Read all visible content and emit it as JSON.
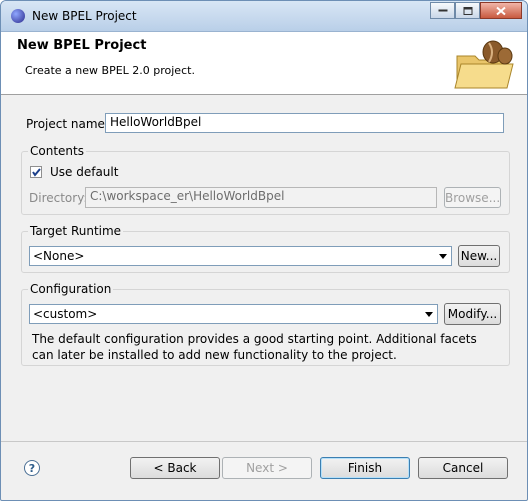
{
  "window": {
    "title": "New BPEL Project",
    "icon": "eclipse-icon",
    "controls": [
      "minimize-icon",
      "maximize-icon",
      "close-icon"
    ]
  },
  "banner": {
    "title": "New BPEL Project",
    "description": "Create a new BPEL 2.0 project."
  },
  "project_name": {
    "label": "Project name:",
    "value": "HelloWorldBpel"
  },
  "contents": {
    "group_label": "Contents",
    "use_default_label": "Use default",
    "use_default_checked": true,
    "directory_label": "Directory:",
    "directory_value": "C:\\workspace_er\\HelloWorldBpel",
    "browse_label": "Browse..."
  },
  "target_runtime": {
    "group_label": "Target Runtime",
    "selected": "<None>",
    "new_label": "New..."
  },
  "configuration": {
    "group_label": "Configuration",
    "selected": "<custom>",
    "modify_label": "Modify...",
    "description": "The default configuration provides a good starting point. Additional facets can later be installed to add new functionality to the project."
  },
  "footer": {
    "help_symbol": "?",
    "back_label": "< Back",
    "next_label": "Next >",
    "finish_label": "Finish",
    "cancel_label": "Cancel"
  }
}
